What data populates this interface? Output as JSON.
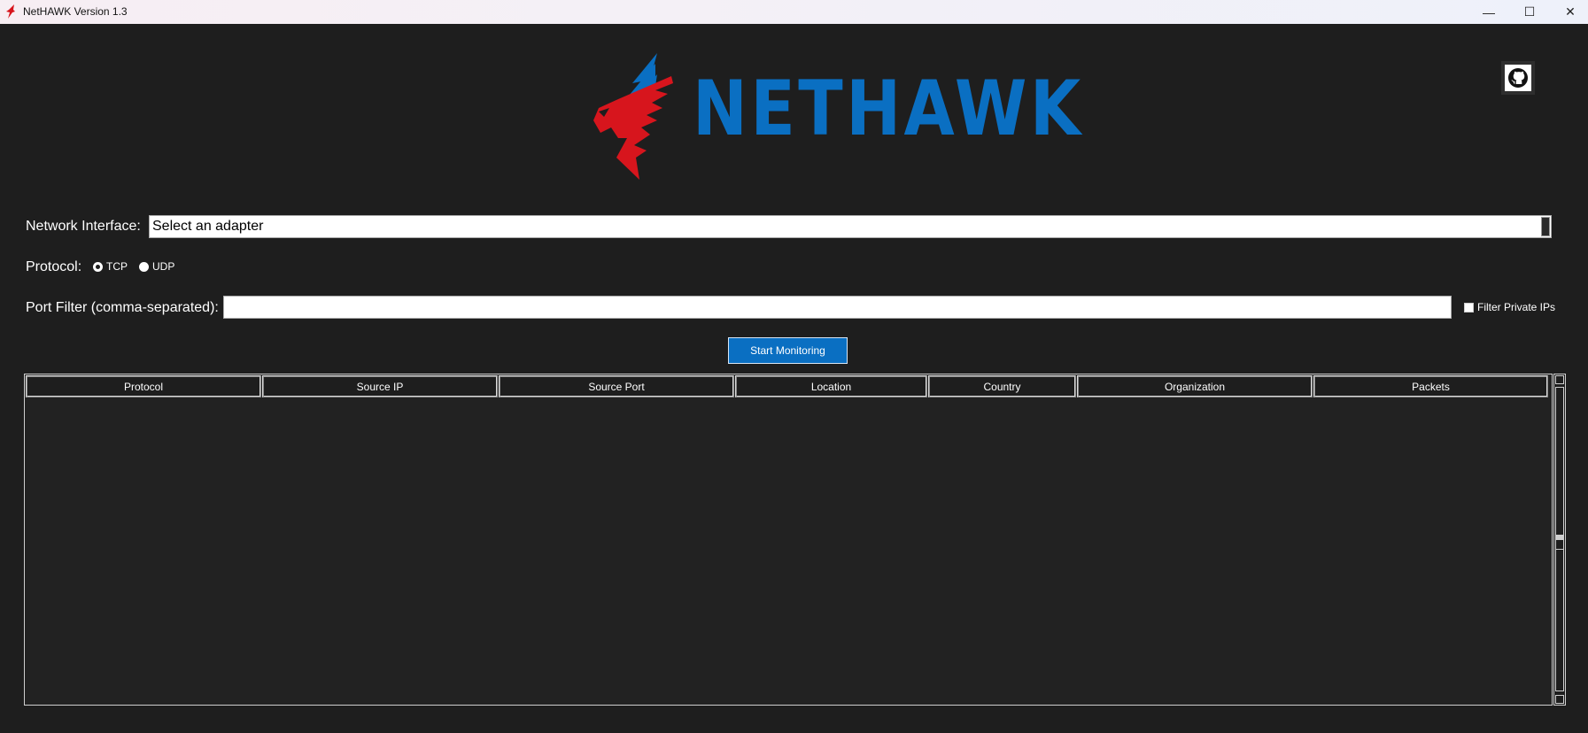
{
  "window": {
    "title": "NetHAWK Version 1.3",
    "controls": {
      "minimize": "—",
      "maximize": "☐",
      "close": "✕"
    }
  },
  "logo": {
    "text": "NETHAWK",
    "colors": {
      "wing_red": "#d7151d",
      "wing_blue": "#0a6fc2",
      "text": "#0a6fc2"
    }
  },
  "github": {
    "icon": "github-icon"
  },
  "form": {
    "network_interface": {
      "label": "Network Interface:",
      "value": "Select an adapter"
    },
    "protocol": {
      "label": "Protocol:",
      "options": [
        {
          "label": "TCP",
          "selected": true
        },
        {
          "label": "UDP",
          "selected": false
        }
      ]
    },
    "port_filter": {
      "label": "Port Filter (comma-separated):",
      "value": ""
    },
    "filter_private": {
      "label": "Filter Private IPs",
      "checked": false
    },
    "start_button": "Start Monitoring"
  },
  "table": {
    "columns": [
      "Protocol",
      "Source IP",
      "Source Port",
      "Location",
      "Country",
      "Organization",
      "Packets"
    ],
    "rows": []
  },
  "colors": {
    "background": "#1e1e1e",
    "accent": "#0a6fc2"
  }
}
